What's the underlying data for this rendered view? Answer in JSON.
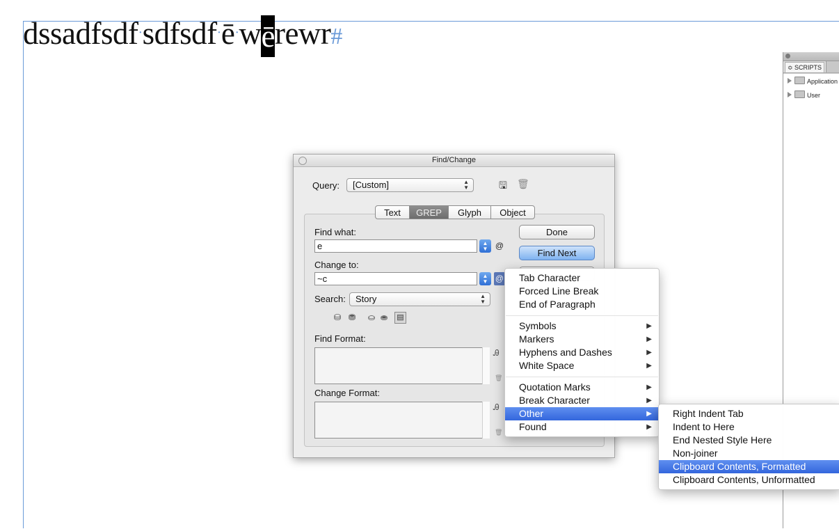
{
  "document": {
    "words": [
      "dssadfsdf",
      "sdfsdf",
      "ē",
      "w"
    ],
    "selected": "ē",
    "after": "rewr",
    "end_marker": "#"
  },
  "scripts_panel": {
    "tab": "≎ SCRIPTS",
    "folders": [
      "Application",
      "User"
    ]
  },
  "dialog": {
    "title": "Find/Change",
    "query_label": "Query:",
    "query_value": "[Custom]",
    "tabs": [
      "Text",
      "GREP",
      "Glyph",
      "Object"
    ],
    "active_tab": "GREP",
    "find_what_label": "Find what:",
    "find_what_value": "e",
    "change_to_label": "Change to:",
    "change_to_value": "~c",
    "search_label": "Search:",
    "search_value": "Story",
    "find_format_label": "Find Format:",
    "change_format_label": "Change Format:",
    "buttons": {
      "done": "Done",
      "find_next": "Find Next"
    }
  },
  "special_menu": {
    "group1": [
      "Tab Character",
      "Forced Line Break",
      "End of Paragraph"
    ],
    "group2": [
      "Symbols",
      "Markers",
      "Hyphens and Dashes",
      "White Space"
    ],
    "group3": [
      "Quotation Marks",
      "Break Character",
      "Other",
      "Found"
    ],
    "highlighted": "Other"
  },
  "other_submenu": {
    "items": [
      "Right Indent Tab",
      "Indent to Here",
      "End Nested Style Here",
      "Non-joiner",
      "Clipboard Contents, Formatted",
      "Clipboard Contents, Unformatted"
    ],
    "highlighted": "Clipboard Contents, Formatted"
  },
  "colors": {
    "menu_highlight": "#3366dd",
    "frame_guide": "#6a9ad8"
  }
}
